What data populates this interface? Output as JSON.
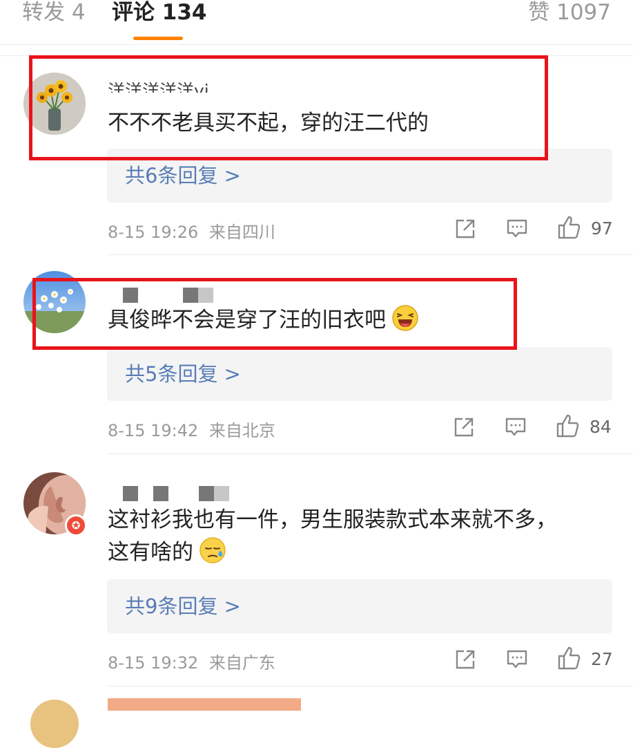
{
  "tabs": {
    "repost": "转发 4",
    "comments": "评论 134",
    "likes": "赞 1097"
  },
  "colors": {
    "accent": "#ff8200",
    "link": "#587db6",
    "highlight": "#e8141b"
  },
  "comments": [
    {
      "username": "洋洋洋洋洋yi",
      "text": "不不不老具买不起，穿的汪二代的",
      "emoji": "",
      "replies": "共6条回复 >",
      "time": "8-15 19:26",
      "location": "来自四川",
      "likes": "97"
    },
    {
      "username": "",
      "text": "具俊晔不会是穿了汪的旧衣吧",
      "emoji": "laughing-emoji",
      "replies": "共5条回复 >",
      "time": "8-15 19:42",
      "location": "来自北京",
      "likes": "84"
    },
    {
      "username": "",
      "text_line1": "这衬衫我也有一件，男生服装款式本来就不多，",
      "text_line2": "这有啥的",
      "emoji": "sweat-emoji",
      "replies": "共9条回复 >",
      "time": "8-15 19:32",
      "location": "来自广东",
      "likes": "27"
    }
  ],
  "icons": [
    "share-icon",
    "comment-icon",
    "like-icon"
  ]
}
